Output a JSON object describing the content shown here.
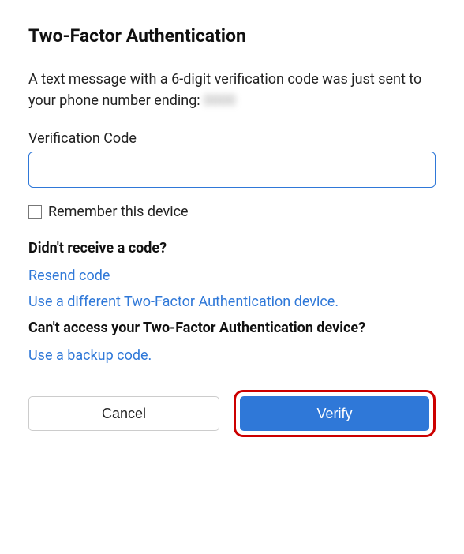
{
  "title": "Two-Factor Authentication",
  "description_prefix": "A text message with a 6-digit verification code was just sent to your phone number ending: ",
  "phone_ending_masked": "0000",
  "field": {
    "label": "Verification Code",
    "value": ""
  },
  "remember": {
    "label": "Remember this device",
    "checked": false
  },
  "help": {
    "no_code_heading": "Didn't receive a code?",
    "resend_link": "Resend code",
    "different_device_link": "Use a different Two-Factor Authentication device.",
    "cant_access_heading": "Can't access your Two-Factor Authentication device?",
    "backup_link": "Use a backup code."
  },
  "actions": {
    "cancel": "Cancel",
    "verify": "Verify"
  }
}
